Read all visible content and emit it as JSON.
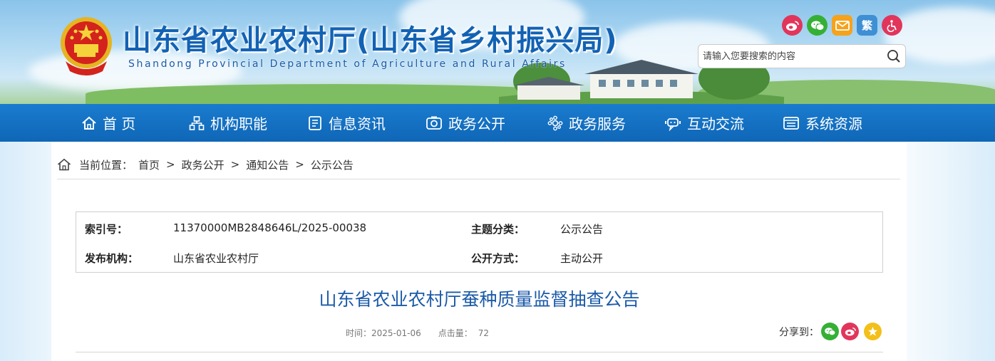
{
  "header": {
    "title": "山东省农业农村厅(山东省乡村振兴局)",
    "subtitle": "Shandong Provincial Department of Agriculture and Rural Affairs",
    "social": [
      {
        "icon": "weibo-icon",
        "label": "",
        "color": "#e2355b"
      },
      {
        "icon": "wechat-icon",
        "label": "",
        "color": "#35b035"
      },
      {
        "icon": "mail-icon",
        "label": "",
        "color": "#f6a21b"
      },
      {
        "icon": "traditional-chinese",
        "label": "繁",
        "color": "#3f8fd4"
      },
      {
        "icon": "accessibility-icon",
        "label": "",
        "color": "#e2355b"
      }
    ],
    "search": {
      "placeholder": "请输入您要搜索的内容"
    }
  },
  "nav": {
    "items": [
      {
        "label": "首 页",
        "icon": "home-icon"
      },
      {
        "label": "机构职能",
        "icon": "organization-icon"
      },
      {
        "label": "信息资讯",
        "icon": "news-icon"
      },
      {
        "label": "政务公开",
        "icon": "disclosure-icon"
      },
      {
        "label": "政务服务",
        "icon": "service-icon"
      },
      {
        "label": "互动交流",
        "icon": "interaction-icon"
      },
      {
        "label": "系统资源",
        "icon": "resources-icon"
      }
    ]
  },
  "breadcrumb": {
    "prefix": "当前位置：",
    "items": [
      "首页",
      "政务公开",
      "通知公告",
      "公示公告"
    ],
    "separator": ">"
  },
  "meta": {
    "index_key": "索引号：",
    "index_value": "11370000MB2848646L/2025-00038",
    "topic_key": "主题分类：",
    "topic_value": "公示公告",
    "publisher_key": "发布机构：",
    "publisher_value": "山东省农业农村厅",
    "mode_key": "公开方式：",
    "mode_value": "主动公开"
  },
  "article": {
    "title": "山东省农业农村厅蚕种质量监督抽查公告",
    "time_label": "时间：",
    "time_value": "2025-01-06",
    "clicks_label": "点击量：",
    "clicks_value": "72",
    "share_label": "分享到：",
    "share": [
      {
        "icon": "wechat-icon",
        "color": "#35b035"
      },
      {
        "icon": "weibo-icon",
        "color": "#e2355b"
      },
      {
        "icon": "qzone-icon",
        "color": "#f3c019"
      }
    ]
  },
  "colors": {
    "nav_bg": "#0f66b6",
    "title_blue": "#1262b4",
    "article_title": "#1b5aa8"
  }
}
